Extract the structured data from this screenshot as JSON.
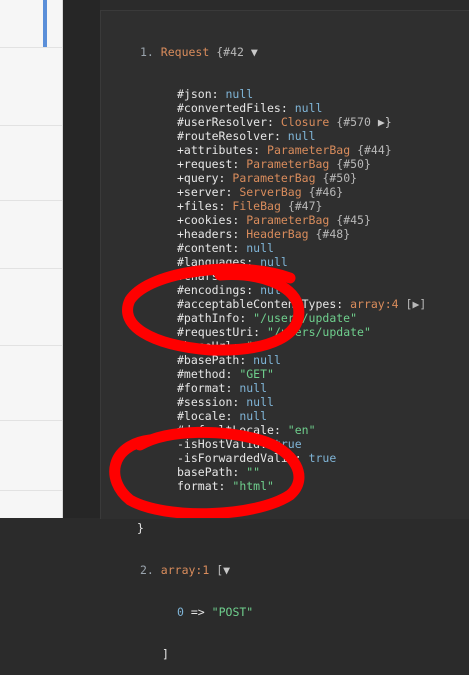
{
  "dump": {
    "entry1_index": "1.",
    "entry1_class": "Request",
    "entry1_brace": "{",
    "entry1_hash": "#42",
    "entry1_toggle": "▼",
    "properties": [
      {
        "key": "#json",
        "value": "null",
        "type": "null"
      },
      {
        "key": "#convertedFiles",
        "value": "null",
        "type": "null"
      },
      {
        "key": "#userResolver",
        "value": "Closure",
        "type": "cls",
        "hash": "{#570",
        "toggle": "▶}"
      },
      {
        "key": "#routeResolver",
        "value": "null",
        "type": "null"
      },
      {
        "key": "+attributes",
        "value": "ParameterBag",
        "type": "cls",
        "hash": "{#44}"
      },
      {
        "key": "+request",
        "value": "ParameterBag",
        "type": "cls",
        "hash": "{#50}"
      },
      {
        "key": "+query",
        "value": "ParameterBag",
        "type": "cls",
        "hash": "{#50}"
      },
      {
        "key": "+server",
        "value": "ServerBag",
        "type": "cls",
        "hash": "{#46}"
      },
      {
        "key": "+files",
        "value": "FileBag",
        "type": "cls",
        "hash": "{#47}"
      },
      {
        "key": "+cookies",
        "value": "ParameterBag",
        "type": "cls",
        "hash": "{#45}"
      },
      {
        "key": "+headers",
        "value": "HeaderBag",
        "type": "cls",
        "hash": "{#48}"
      },
      {
        "key": "#content",
        "value": "null",
        "type": "null"
      },
      {
        "key": "#languages",
        "value": "null",
        "type": "null"
      },
      {
        "key": "#charsets",
        "value": "null",
        "type": "null"
      },
      {
        "key": "#encodings",
        "value": "null",
        "type": "null"
      },
      {
        "key": "#acceptableContentTypes",
        "value": "array:4",
        "type": "cls",
        "hash": "[▶]"
      },
      {
        "key": "#pathInfo",
        "value": "\"/users/update\"",
        "type": "str"
      },
      {
        "key": "#requestUri",
        "value": "\"/users/update\"",
        "type": "str"
      },
      {
        "key": "#baseUrl",
        "value": "\"\"",
        "type": "str"
      },
      {
        "key": "#basePath",
        "value": "null",
        "type": "null"
      },
      {
        "key": "#method",
        "value": "\"GET\"",
        "type": "str"
      },
      {
        "key": "#format",
        "value": "null",
        "type": "null"
      },
      {
        "key": "#session",
        "value": "null",
        "type": "null"
      },
      {
        "key": "#locale",
        "value": "null",
        "type": "null"
      },
      {
        "key": "#defaultLocale",
        "value": "\"en\"",
        "type": "str"
      },
      {
        "key": "-isHostValid",
        "value": "true",
        "type": "bool"
      },
      {
        "key": "-isForwardedValid",
        "value": "true",
        "type": "bool"
      },
      {
        "key": "basePath",
        "value": "\"\"",
        "type": "str"
      },
      {
        "key": "format",
        "value": "\"html\"",
        "type": "str"
      }
    ],
    "entry1_close": "}",
    "entry2_index": "2.",
    "entry2_type": "array:1",
    "entry2_open": "[",
    "entry2_toggle": "▼",
    "entry2_item_key": "0",
    "entry2_item_arrow": "=>",
    "entry2_item_value": "\"POST\"",
    "entry2_close": "]"
  },
  "colors": {
    "background": "#2b2b2b",
    "class_name": "#d98c5c",
    "string": "#6fcf8d",
    "null": "#7fb4d6",
    "annotation_marker": "#ff0000"
  }
}
